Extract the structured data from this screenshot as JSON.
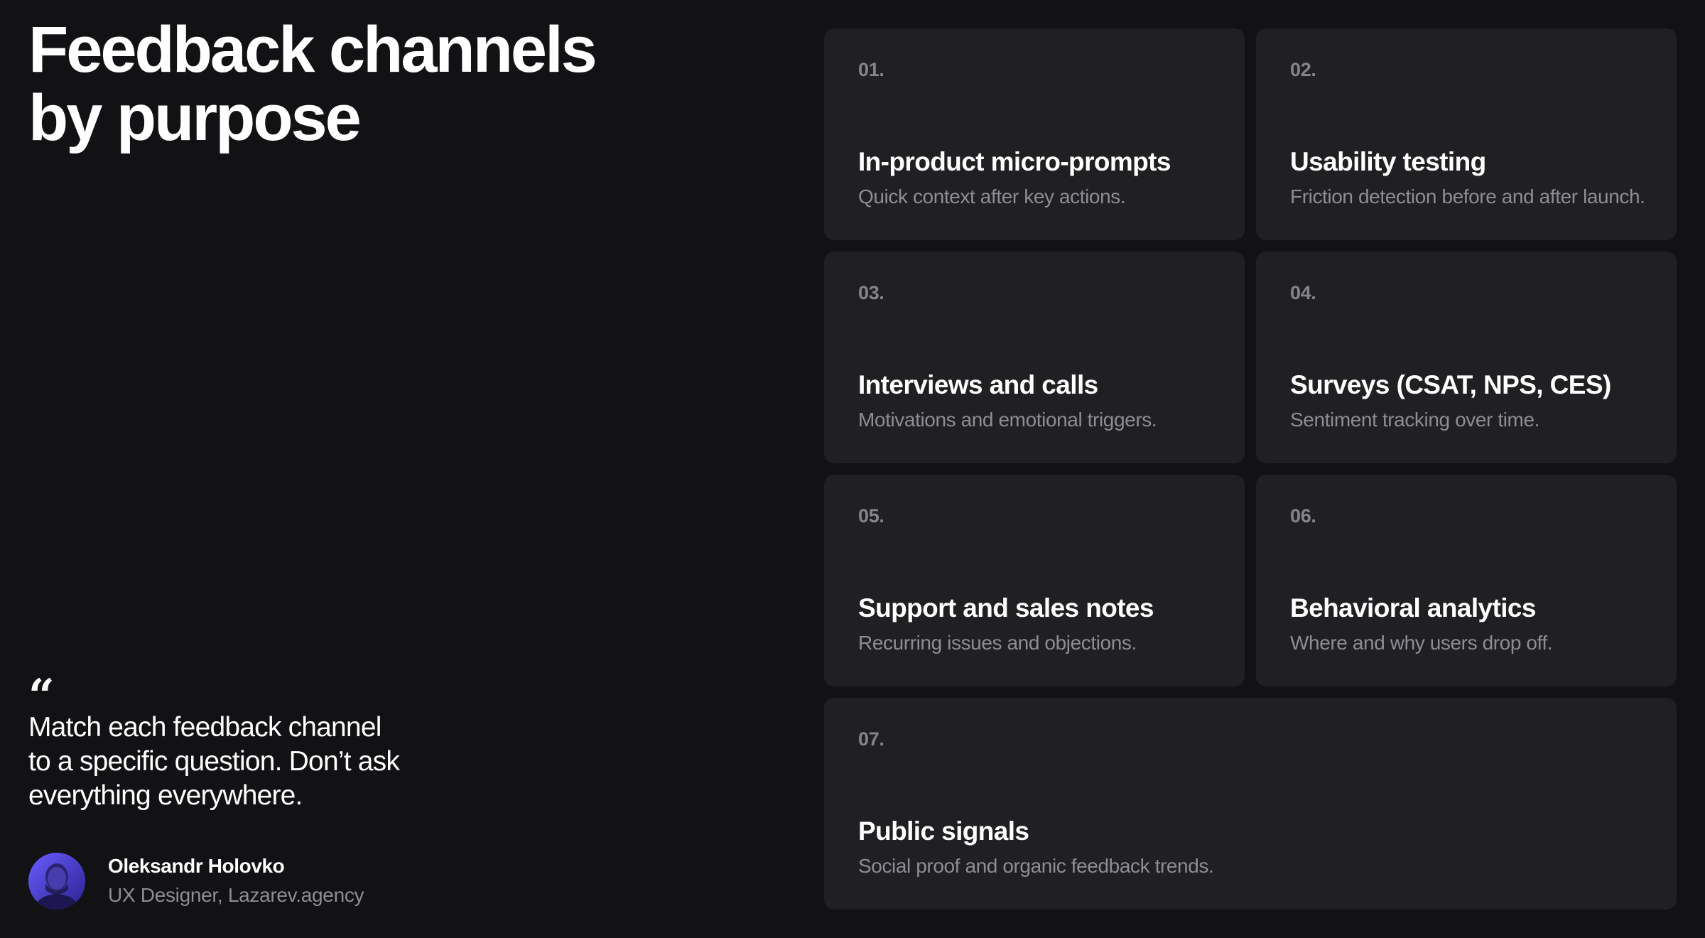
{
  "title": {
    "line1": "Feedback channels",
    "line2": "by purpose"
  },
  "quote": {
    "mark": "“",
    "line1": "Match each feedback channel",
    "line2": "to a specific question. Don’t ask",
    "line3": "everything everywhere."
  },
  "author": {
    "name": "Oleksandr Holovko",
    "role": "UX Designer, Lazarev.agency",
    "avatar_icon": "person-avatar"
  },
  "cards": [
    {
      "number": "01.",
      "title": "In-product micro-prompts",
      "description": "Quick context after key actions."
    },
    {
      "number": "02.",
      "title": "Usability testing",
      "description": "Friction detection before and after launch."
    },
    {
      "number": "03.",
      "title": "Interviews and calls",
      "description": "Motivations and emotional triggers."
    },
    {
      "number": "04.",
      "title": "Surveys (CSAT, NPS, CES)",
      "description": "Sentiment tracking over time."
    },
    {
      "number": "05.",
      "title": "Support and sales notes",
      "description": "Recurring issues and objections."
    },
    {
      "number": "06.",
      "title": "Behavioral analytics",
      "description": "Where and why users drop off."
    },
    {
      "number": "07.",
      "title": "Public signals",
      "description": "Social proof and organic feedback trends."
    }
  ],
  "colors": {
    "background": "#121114",
    "card": "#202023",
    "text_primary": "#ffffff",
    "text_secondary": "#8e8c94",
    "number": "#85838b",
    "avatar_accent": "#3b2fc9"
  }
}
